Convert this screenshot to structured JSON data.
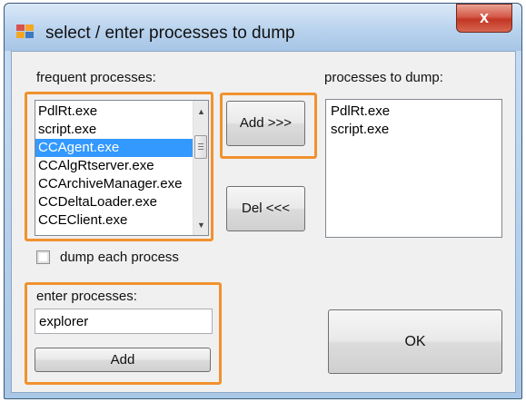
{
  "window": {
    "title": "select / enter processes to dump",
    "close_label": "x"
  },
  "frequent": {
    "label": "frequent processes:",
    "items": [
      "PdlRt.exe",
      "script.exe",
      "CCAgent.exe",
      "CCAlgRtserver.exe",
      "CCArchiveManager.exe",
      "CCDeltaLoader.exe",
      "CCEClient.exe"
    ],
    "selected_index": 2
  },
  "dump": {
    "label": "processes to dump:",
    "items": [
      "PdlRt.exe",
      "script.exe"
    ]
  },
  "buttons": {
    "add_arrow": "Add >>>",
    "del_arrow": "Del <<<",
    "add": "Add",
    "ok": "OK"
  },
  "checkbox": {
    "label": "dump each process",
    "checked": false
  },
  "enter": {
    "label": "enter processes:",
    "value": "explorer"
  },
  "colors": {
    "highlight": "#f0922e",
    "selection": "#3399ff"
  }
}
